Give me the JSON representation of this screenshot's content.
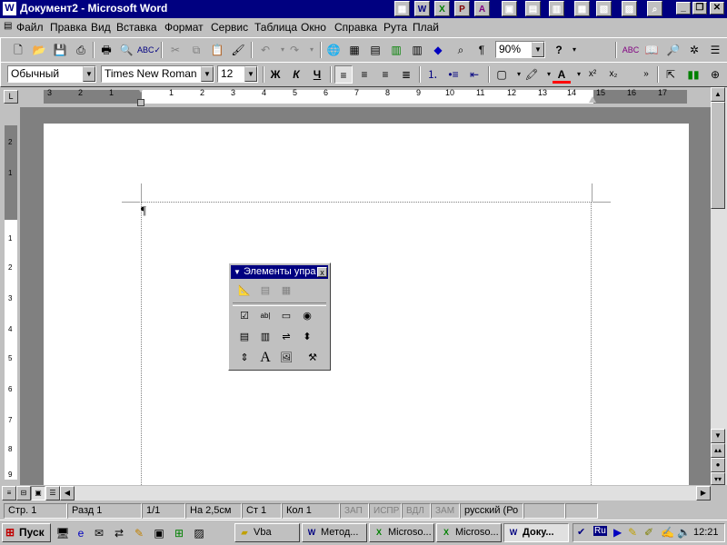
{
  "window": {
    "title": "Документ2 - Microsoft Word",
    "app_icon": "W",
    "quick_launch": [
      "W",
      "X",
      "P",
      "A",
      "▣",
      "▤",
      "▥",
      "▦",
      "▧",
      "▨",
      "▩",
      "⌕"
    ]
  },
  "menu": [
    "Файл",
    "Правка",
    "Вид",
    "Вставка",
    "Формат",
    "Сервис",
    "Таблица",
    "Окно",
    "Справка",
    "Рута",
    "Плай"
  ],
  "standard_toolbar": {
    "zoom": "90%",
    "help_label": "?"
  },
  "formatting_toolbar": {
    "style": "Обычный",
    "font": "Times New Roman",
    "size": "12",
    "bold": "Ж",
    "italic": "К",
    "underline": "Ч",
    "superscript": "x²",
    "subscript": "x₂"
  },
  "ruler": {
    "numbers_left": [
      "3",
      "2",
      "1"
    ],
    "numbers_right": [
      "1",
      "2",
      "3",
      "4",
      "5",
      "6",
      "7",
      "8",
      "9",
      "10",
      "11",
      "12",
      "13",
      "14",
      "15",
      "16",
      "17"
    ],
    "vnumbers": [
      "2",
      "1",
      "1",
      "2",
      "3",
      "4",
      "5",
      "6",
      "7",
      "8",
      "9"
    ]
  },
  "document": {
    "paragraph_mark": "¶"
  },
  "palette": {
    "title": "Элементы упра",
    "close": "x",
    "text_tool": "A"
  },
  "status": {
    "page": "Стр. 1",
    "section": "Разд 1",
    "pages": "1/1",
    "at": "На 2,5см",
    "line": "Ст 1",
    "col": "Кол 1",
    "rec": "ЗАП",
    "track": "ИСПР",
    "ext": "ВДЛ",
    "ovr": "ЗАМ",
    "language": "русский (Ро"
  },
  "taskbar": {
    "start": "Пуск",
    "tasks": [
      "Vba",
      "Метод...",
      "Microso...",
      "Microso...",
      "Доку..."
    ],
    "lang": "Ru",
    "clock": "12:21"
  },
  "colors": {
    "title_bar": "#000080",
    "desktop_grey": "#c0c0c0",
    "work_area": "#808080"
  }
}
